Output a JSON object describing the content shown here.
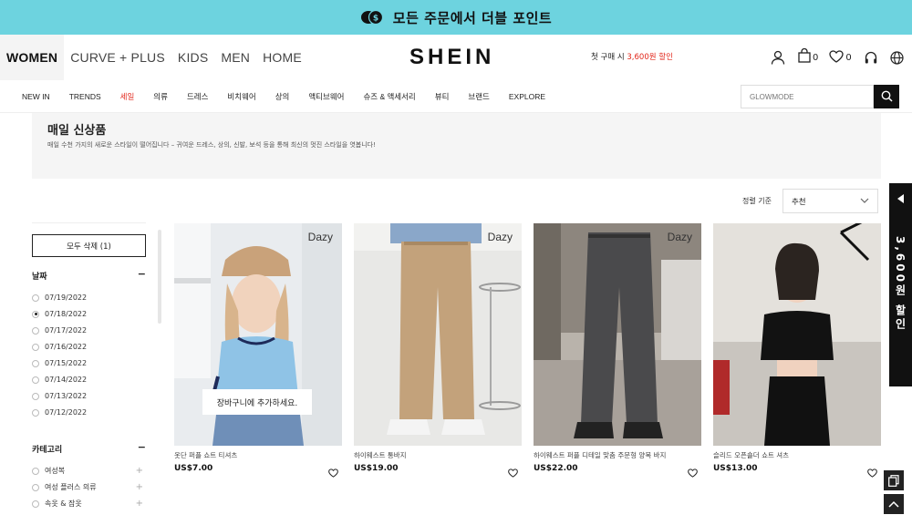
{
  "promo": {
    "text": "모든 주문에서 더블 포인트"
  },
  "header": {
    "top_nav": [
      "WOMEN",
      "CURVE + PLUS",
      "KIDS",
      "MEN",
      "HOME"
    ],
    "logo": "SHEIN",
    "first_buy_prefix": "첫 구매 시 ",
    "first_buy_amount": "3,600원 할인",
    "cart_count": "0",
    "wishlist_count": "0"
  },
  "category_nav": {
    "items": [
      "NEW IN",
      "TRENDS",
      "세일",
      "의류",
      "드레스",
      "비치웨어",
      "상의",
      "액티브웨어",
      "슈즈 & 액세서리",
      "뷰티",
      "브랜드",
      "EXPLORE"
    ],
    "search_placeholder": "GLOWMODE"
  },
  "banner": {
    "title": "매일 신상품",
    "subtitle": "매일 수천 가지의 새로운 스타일이 떨어집니다 – 귀여운 드레스, 상의, 신발, 보석 등을 통해 최신의 멋진 스타일을 엿봅니다!"
  },
  "sort": {
    "label": "정렬 기준",
    "value": "추천"
  },
  "filters": {
    "clear_all": "모두 삭제 (1)",
    "date_title": "날짜",
    "dates": [
      "07/19/2022",
      "07/18/2022",
      "07/17/2022",
      "07/16/2022",
      "07/15/2022",
      "07/14/2022",
      "07/13/2022",
      "07/12/2022"
    ],
    "selected_date_index": 1,
    "category_title": "카테고리",
    "categories": [
      "여성복",
      "여성 플러스 의류",
      "속옷 & 잠옷"
    ]
  },
  "products": [
    {
      "brand": "Dazy",
      "name": "옷단 퍼플 쇼트 티셔츠",
      "price": "US$7.00",
      "cart_popup": "장바구니에 추가하세요."
    },
    {
      "brand": "Dazy",
      "name": "하이웨스트 통바지",
      "price": "US$19.00"
    },
    {
      "brand": "Dazy",
      "name": "하이웨스트 퍼플 디테일 맞춤 주문형 양복 바지",
      "price": "US$22.00"
    },
    {
      "brand": "",
      "name": "슬리드 오픈숄더 쇼트 셔츠",
      "price": "US$13.00"
    }
  ],
  "side_tab": {
    "text": "3,600원 할인"
  },
  "colors": {
    "promo_bg": "#6dd3df",
    "sale_red": "#e2261a",
    "dark": "#111111"
  }
}
